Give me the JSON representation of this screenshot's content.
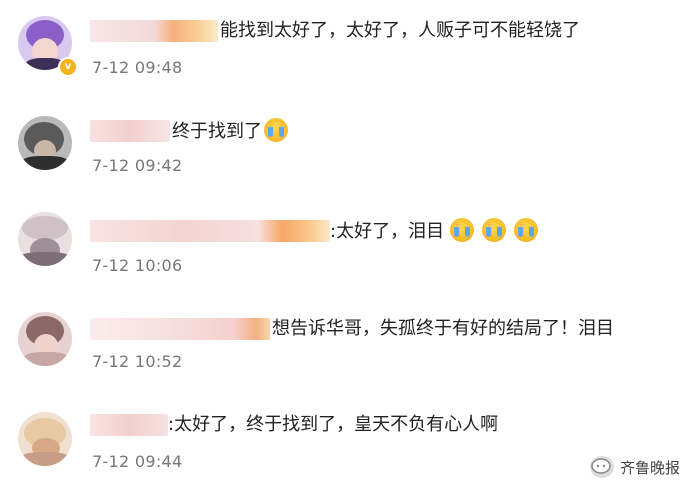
{
  "comments": [
    {
      "text": "能找到太好了，太好了，人贩子可不能轻饶了",
      "time": "7-12 09:48",
      "emoji_count": 0
    },
    {
      "text": "终于找到了",
      "time": "7-12 09:42",
      "emoji_count": 1
    },
    {
      "text": ":太好了，泪目",
      "time": "7-12 10:06",
      "emoji_count": 3
    },
    {
      "text": "想告诉华哥，失孤终于有好的结局了！泪目",
      "time": "7-12 10:52",
      "emoji_count": 0
    },
    {
      "text": ":太好了，终于找到了，皇天不负有心人啊",
      "time": "7-12 09:44",
      "emoji_count": 0
    }
  ],
  "watermark": {
    "label": "齐鲁晚报",
    "icon": "wechat-bubble-icon"
  },
  "colors": {
    "time": "#777777",
    "text": "#222222",
    "badge": "#f6b21b"
  }
}
